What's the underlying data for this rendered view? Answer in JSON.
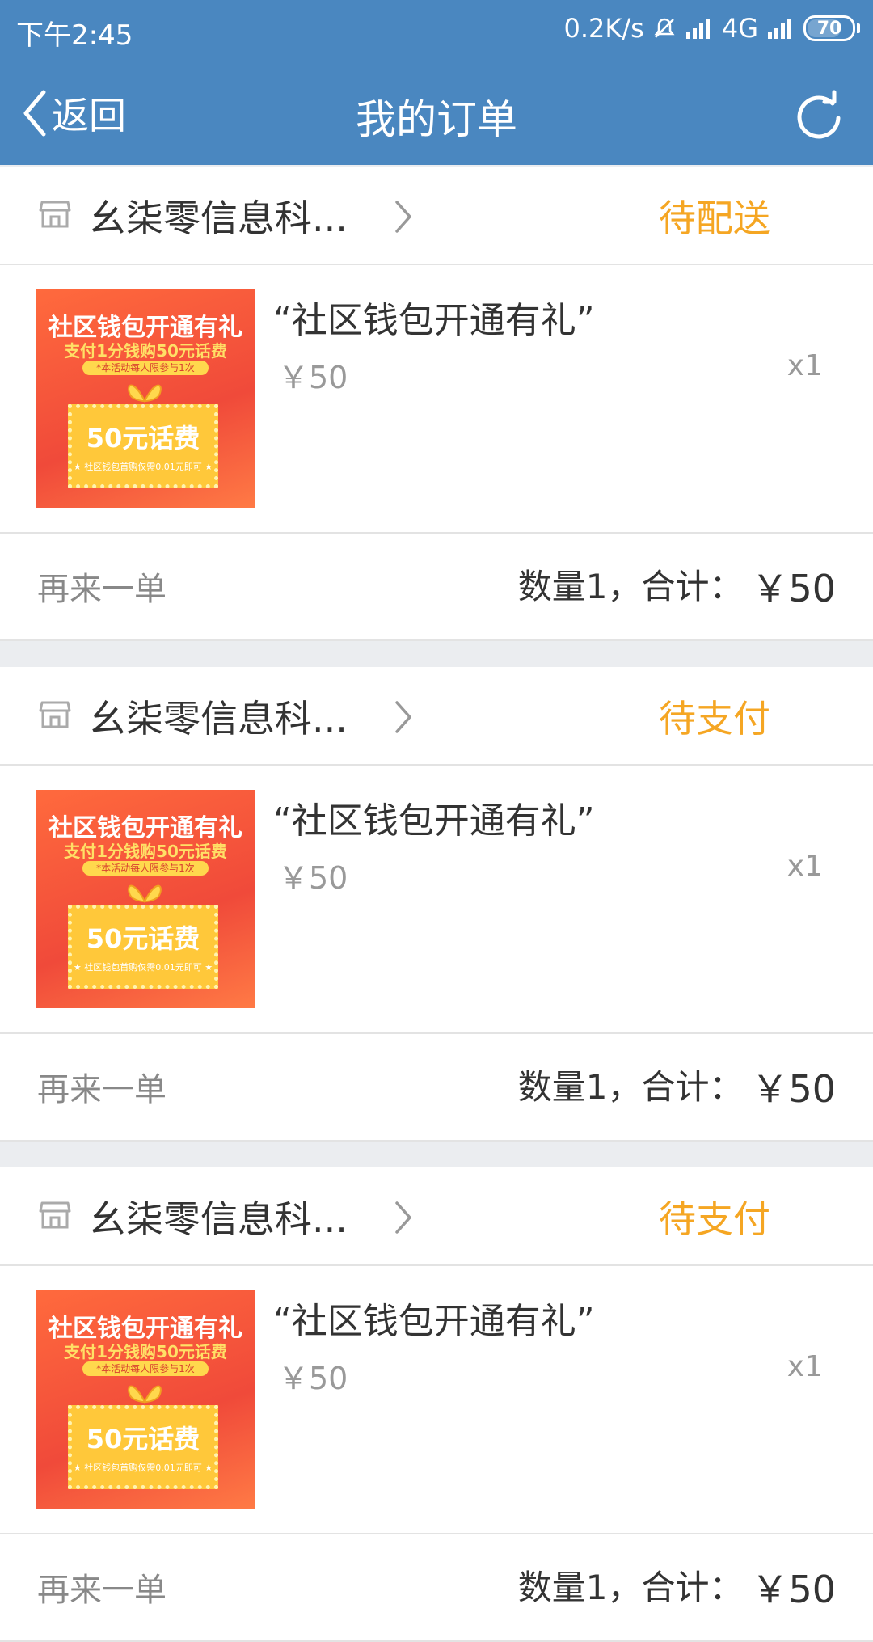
{
  "status_bar": {
    "time": "下午2:45",
    "net_speed": "0.2K/s",
    "network": "4G",
    "battery": "70"
  },
  "nav": {
    "back_label": "返回",
    "title": "我的订单"
  },
  "colors": {
    "header_bg": "#4a87c0",
    "status_orange": "#f5a623",
    "divider_bg": "#ebedf0"
  },
  "orders": [
    {
      "shop_name": "幺柒零信息科...",
      "status": "待配送",
      "item_title": "“社区钱包开通有礼”",
      "item_price": "￥50",
      "item_qty": "x1",
      "reorder_label": "再来一单",
      "summary_label": "数量1，合计：",
      "summary_total": "￥50",
      "image": {
        "line1": "社区钱包开通有礼",
        "line2": "支付1分钱购50元话费",
        "line3": "*本活动每人限参与1次",
        "line4": "50元话费",
        "line5": "★ 社区钱包首购仅需0.01元即可 ★"
      }
    },
    {
      "shop_name": "幺柒零信息科...",
      "status": "待支付",
      "item_title": "“社区钱包开通有礼”",
      "item_price": "￥50",
      "item_qty": "x1",
      "reorder_label": "再来一单",
      "summary_label": "数量1，合计：",
      "summary_total": "￥50",
      "image": {
        "line1": "社区钱包开通有礼",
        "line2": "支付1分钱购50元话费",
        "line3": "*本活动每人限参与1次",
        "line4": "50元话费",
        "line5": "★ 社区钱包首购仅需0.01元即可 ★"
      }
    },
    {
      "shop_name": "幺柒零信息科...",
      "status": "待支付",
      "item_title": "“社区钱包开通有礼”",
      "item_price": "￥50",
      "item_qty": "x1",
      "reorder_label": "再来一单",
      "summary_label": "数量1，合计：",
      "summary_total": "￥50",
      "image": {
        "line1": "社区钱包开通有礼",
        "line2": "支付1分钱购50元话费",
        "line3": "*本活动每人限参与1次",
        "line4": "50元话费",
        "line5": "★ 社区钱包首购仅需0.01元即可 ★"
      }
    }
  ]
}
